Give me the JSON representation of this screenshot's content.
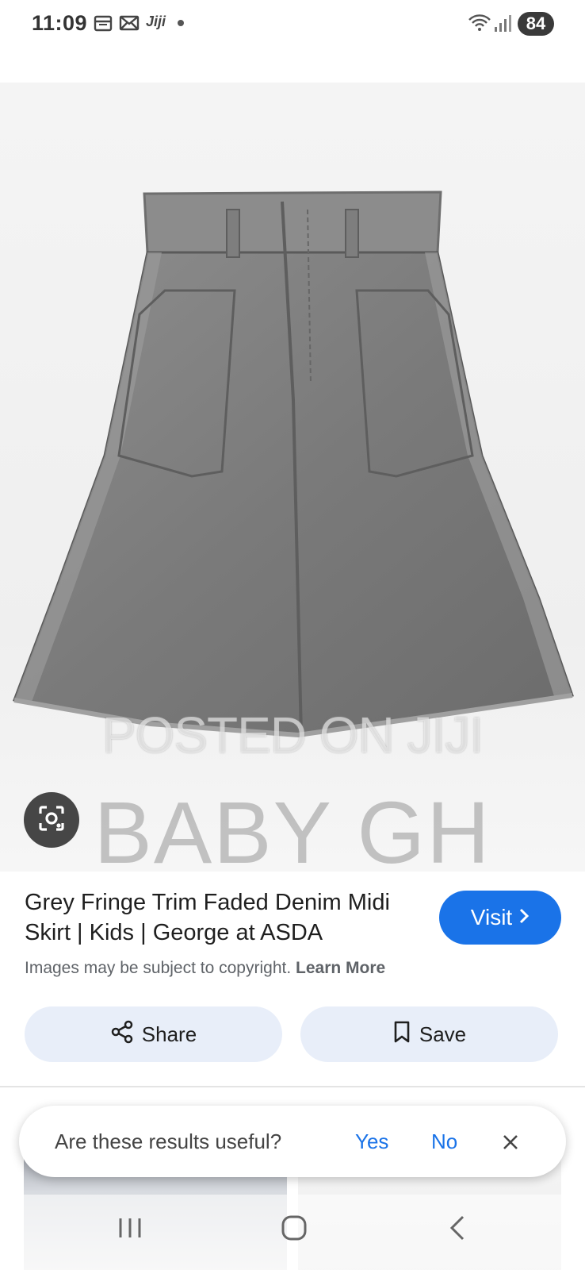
{
  "status_bar": {
    "time": "11:09",
    "app_label": "Jiji",
    "battery": "84"
  },
  "image": {
    "watermark_posted": "POSTED ON JIJI",
    "watermark_brand": "BABY GH"
  },
  "result": {
    "title": "Grey Fringe Trim Faded Denim Midi Skirt | Kids | George at ASDA",
    "visit_label": "Visit",
    "copyright_text": "Images may be subject to copyright.",
    "learn_more_label": "Learn More"
  },
  "actions": {
    "share_label": "Share",
    "save_label": "Save"
  },
  "feedback": {
    "question": "Are these results useful?",
    "yes_label": "Yes",
    "no_label": "No"
  },
  "colors": {
    "accent": "#1a73e8",
    "action_bg": "#e8eef9",
    "lens_bg": "#464646"
  },
  "icons": [
    "calendar-icon",
    "mail-icon",
    "wifi-icon",
    "signal-icon",
    "lens-icon",
    "chevron-right-icon",
    "share-icon",
    "bookmark-icon",
    "close-icon",
    "recent-apps-icon",
    "home-icon",
    "back-icon"
  ]
}
